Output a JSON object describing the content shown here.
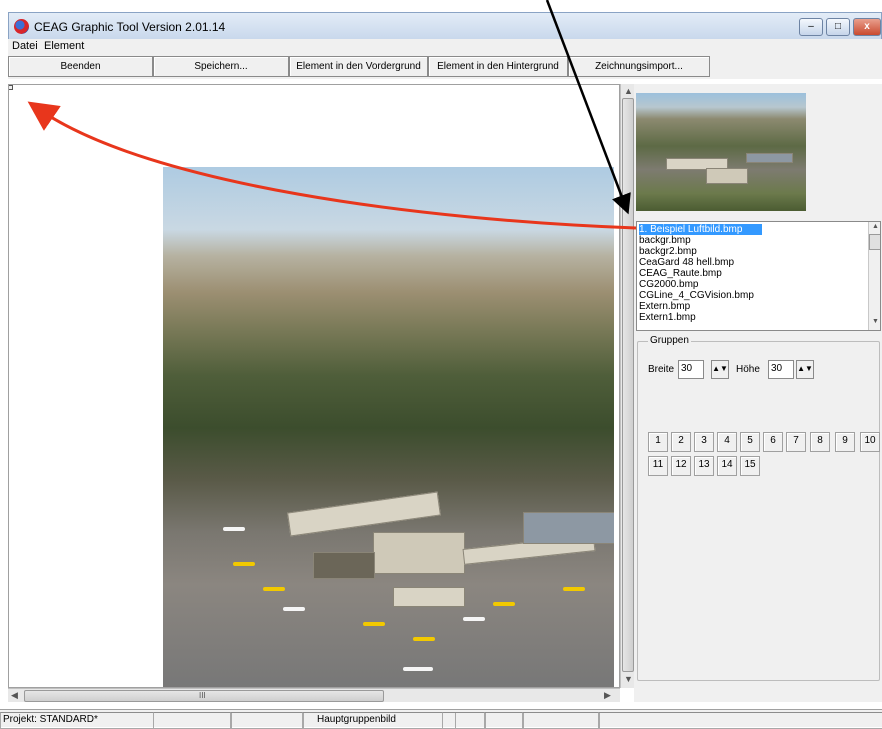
{
  "window": {
    "title": "CEAG Graphic Tool Version 2.01.14",
    "icon": "app-logo-icon",
    "controls": {
      "minimize": "–",
      "maximize": "□",
      "close": "x"
    }
  },
  "menu": [
    {
      "label": "Datei",
      "mnemonic": "D"
    },
    {
      "label": "Element",
      "mnemonic": "E"
    }
  ],
  "toolbar": {
    "beenden": "Beenden",
    "speichern": "Speichern...",
    "vordergrund": "Element in den Vordergrund",
    "hintergrund": "Element in den Hintergrund",
    "import": "Zeichnungsimport..."
  },
  "files": [
    "1. Beispiel Luftbild.bmp",
    "backgr.bmp",
    "backgr2.bmp",
    "CeaGard 48 hell.bmp",
    "CEAG_Raute.bmp",
    "CG2000.bmp",
    "CGLine_4_CGVision.bmp",
    "Extern.bmp",
    "Extern1.bmp"
  ],
  "selected_file_index": 0,
  "gruppen": {
    "legend": "Gruppen",
    "breite_label": "Breite",
    "breite_value": "30",
    "hoehe_label": "Höhe",
    "hoehe_value": "30",
    "buttons": [
      "1",
      "2",
      "3",
      "4",
      "5",
      "6",
      "7",
      "8",
      "9",
      "10",
      "11",
      "12",
      "13",
      "14",
      "15"
    ]
  },
  "scroll": {
    "h_thumb_grip": "III"
  },
  "status": {
    "projekt": "Projekt: STANDARD*",
    "gruppenbild": "Hauptgruppenbild"
  },
  "colors": {
    "selection": "#3399ff",
    "annotation_arrow_red": "#e8361c",
    "annotation_arrow_black": "#000000"
  }
}
